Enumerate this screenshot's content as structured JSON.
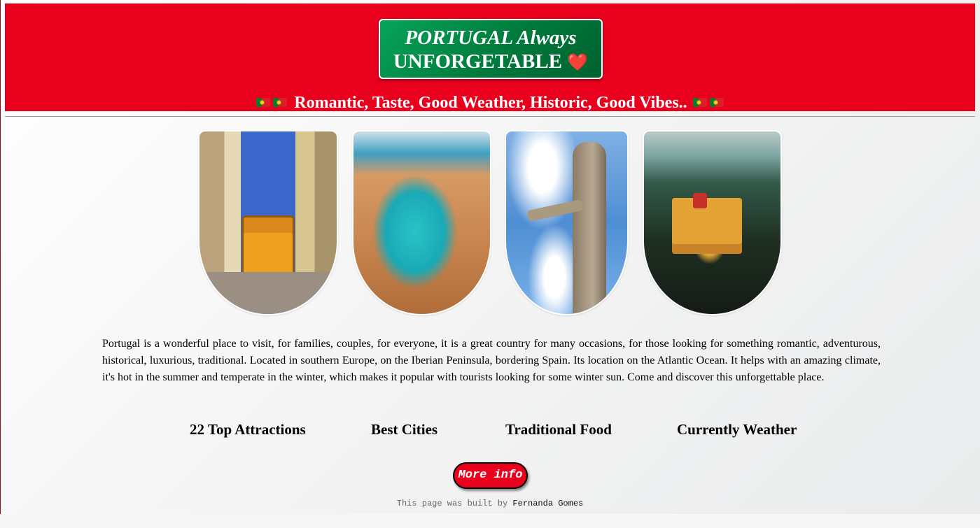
{
  "header": {
    "title_line1": "PORTUGAL Always",
    "title_line2": "UNFORGETABLE",
    "title_emoji": "❤️",
    "tagline": "Romantic, Taste, Good Weather, Historic, Good Vibes..",
    "flag_icon": "portugal-flag-icon",
    "band_color": "#e8001c",
    "title_box_color": "#008f48"
  },
  "gallery": {
    "photos": [
      {
        "subject": "lisbon-tram"
      },
      {
        "subject": "algarve-coast"
      },
      {
        "subject": "christ-statue"
      },
      {
        "subject": "pena-palace"
      }
    ]
  },
  "intro": {
    "text": "Portugal is a wonderful place to visit, for families, couples, for everyone, it is a great country for many occasions, for those looking for something romantic, adventurous, historical, luxurious, traditional. Located in southern Europe, on the Iberian Peninsula, bordering Spain. Its location on the Atlantic Ocean. It helps with an amazing climate, it's hot in the summer and temperate in the winter, which makes it popular with tourists looking for some winter sun. Come and discover this unforgettable place."
  },
  "nav": {
    "items": [
      {
        "label": "22 Top Attractions"
      },
      {
        "label": "Best Cities"
      },
      {
        "label": "Traditional Food"
      },
      {
        "label": "Currently Weather"
      }
    ]
  },
  "cta": {
    "label": "More info",
    "color": "#e8001c"
  },
  "footer": {
    "prefix": "This page was built by",
    "author": "Fernanda Gomes"
  }
}
